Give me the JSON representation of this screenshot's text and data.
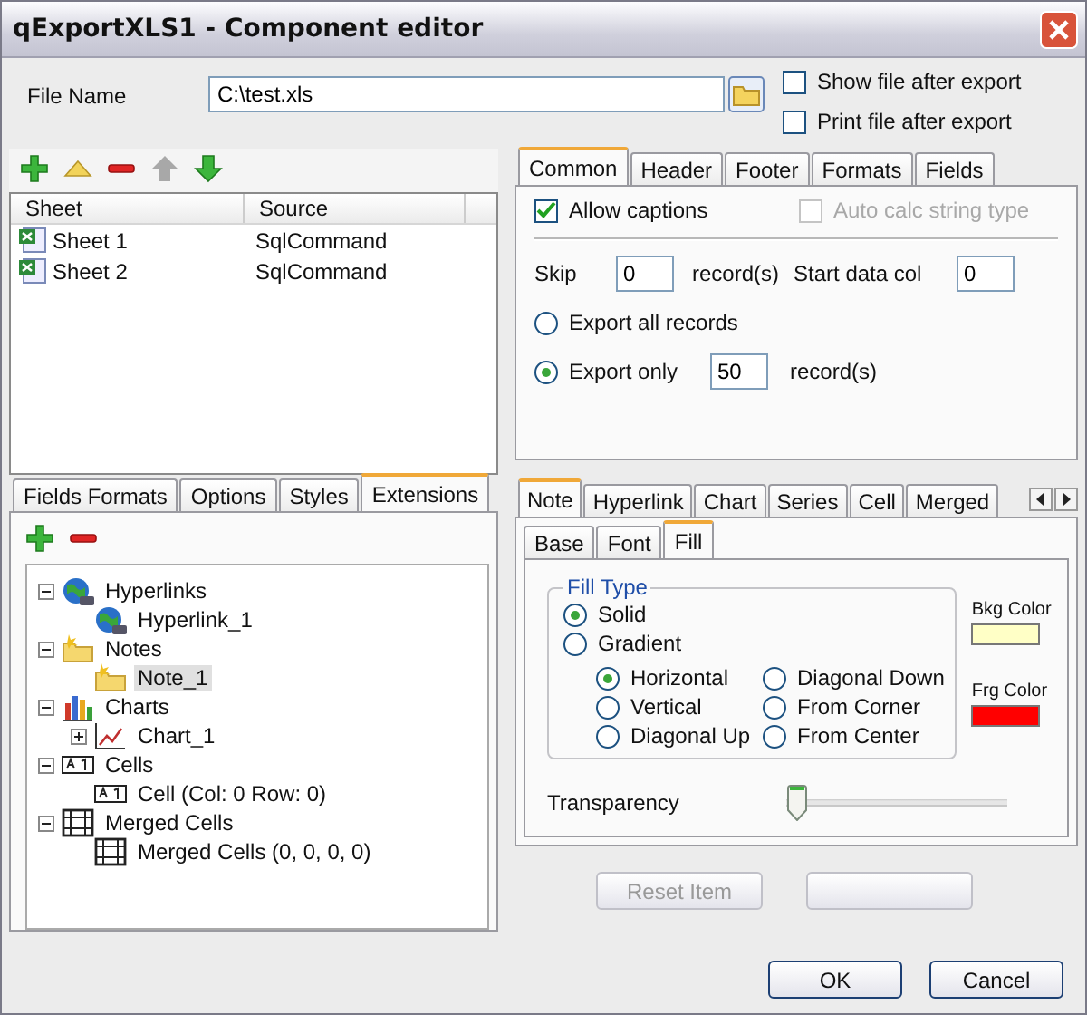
{
  "window": {
    "title": "qExportXLS1 - Component editor"
  },
  "file": {
    "label": "File Name",
    "value": "C:\\test.xls"
  },
  "options": [
    {
      "label": "Show file after export",
      "checked": false
    },
    {
      "label": "Print file after export",
      "checked": false
    }
  ],
  "sheet_toolbar": [
    {
      "kind": "add",
      "disabled": false
    },
    {
      "kind": "edit",
      "disabled": false
    },
    {
      "kind": "remove",
      "disabled": false
    },
    {
      "kind": "up",
      "disabled": true
    },
    {
      "kind": "down",
      "disabled": false
    }
  ],
  "sheets": {
    "columns": [
      "Sheet",
      "Source"
    ],
    "rows": [
      {
        "sheet": "Sheet 1",
        "source": "SqlCommand"
      },
      {
        "sheet": "Sheet 2",
        "source": "SqlCommand"
      }
    ]
  },
  "left_tabs": [
    {
      "label": "Fields Formats",
      "selected": false
    },
    {
      "label": "Options",
      "selected": false
    },
    {
      "label": "Styles",
      "selected": false
    },
    {
      "label": "Extensions",
      "selected": true
    }
  ],
  "extensions_toolbar": [
    {
      "kind": "add"
    },
    {
      "kind": "remove"
    }
  ],
  "tree": [
    {
      "label": "Hyperlinks",
      "kind": "hyperlink",
      "expanded": true,
      "selected": false,
      "children": [
        {
          "label": "Hyperlink_1",
          "kind": "hyperlink",
          "selected": false
        }
      ]
    },
    {
      "label": "Notes",
      "kind": "note",
      "expanded": true,
      "selected": false,
      "children": [
        {
          "label": "Note_1",
          "kind": "note",
          "selected": true
        }
      ]
    },
    {
      "label": "Charts",
      "kind": "chart",
      "expanded": true,
      "selected": false,
      "children": [
        {
          "label": "Chart_1",
          "kind": "linechart",
          "expanded": false,
          "selected": false
        }
      ]
    },
    {
      "label": "Cells",
      "kind": "cell",
      "expanded": true,
      "selected": false,
      "children": [
        {
          "label": "Cell (Col: 0 Row: 0)",
          "kind": "cell",
          "selected": false
        }
      ]
    },
    {
      "label": "Merged Cells",
      "kind": "merged",
      "expanded": true,
      "selected": false,
      "children": [
        {
          "label": "Merged Cells (0, 0, 0, 0)",
          "kind": "merged",
          "selected": false
        }
      ]
    }
  ],
  "export_tabs": [
    {
      "label": "Common",
      "selected": true
    },
    {
      "label": "Header",
      "selected": false
    },
    {
      "label": "Footer",
      "selected": false
    },
    {
      "label": "Formats",
      "selected": false
    },
    {
      "label": "Fields",
      "selected": false
    }
  ],
  "common": {
    "allow_captions": {
      "label": "Allow captions",
      "checked": true,
      "disabled": false
    },
    "auto_calc": {
      "label": "Auto calc string type",
      "checked": false,
      "disabled": true
    },
    "skip": {
      "label": "Skip",
      "value": "0",
      "unit": "record(s)"
    },
    "start_col": {
      "label": "Start data col",
      "value": "0"
    },
    "export_mode": [
      {
        "label": "Export all records",
        "selected": false
      },
      {
        "label": "Export only",
        "selected": true
      }
    ],
    "export_only": {
      "value": "50",
      "unit": "record(s)"
    }
  },
  "item_tabs": [
    {
      "label": "Note",
      "selected": true
    },
    {
      "label": "Hyperlink",
      "selected": false
    },
    {
      "label": "Chart",
      "selected": false
    },
    {
      "label": "Series",
      "selected": false
    },
    {
      "label": "Cell",
      "selected": false
    },
    {
      "label": "Merged",
      "selected": false
    }
  ],
  "item_subtabs": [
    {
      "label": "Base",
      "selected": false
    },
    {
      "label": "Font",
      "selected": false
    },
    {
      "label": "Fill",
      "selected": true
    }
  ],
  "fill": {
    "group_title": "Fill Type",
    "types": [
      {
        "label": "Solid",
        "selected": true
      },
      {
        "label": "Gradient",
        "selected": false
      }
    ],
    "gradient_styles": [
      {
        "label": "Horizontal",
        "selected": true
      },
      {
        "label": "Vertical",
        "selected": false
      },
      {
        "label": "Diagonal Up",
        "selected": false
      },
      {
        "label": "Diagonal Down",
        "selected": false
      },
      {
        "label": "From Corner",
        "selected": false
      },
      {
        "label": "From Center",
        "selected": false
      }
    ],
    "bkg": {
      "label": "Bkg Color",
      "color": "#ffffc6"
    },
    "frg": {
      "label": "Frg Color",
      "color": "#ff0000"
    },
    "transparency": {
      "label": "Transparency",
      "level": 0
    }
  },
  "item_buttons": [
    {
      "label": "Reset Item",
      "disabled": true
    }
  ],
  "buttons": [
    {
      "label": "OK"
    },
    {
      "label": "Cancel"
    }
  ]
}
